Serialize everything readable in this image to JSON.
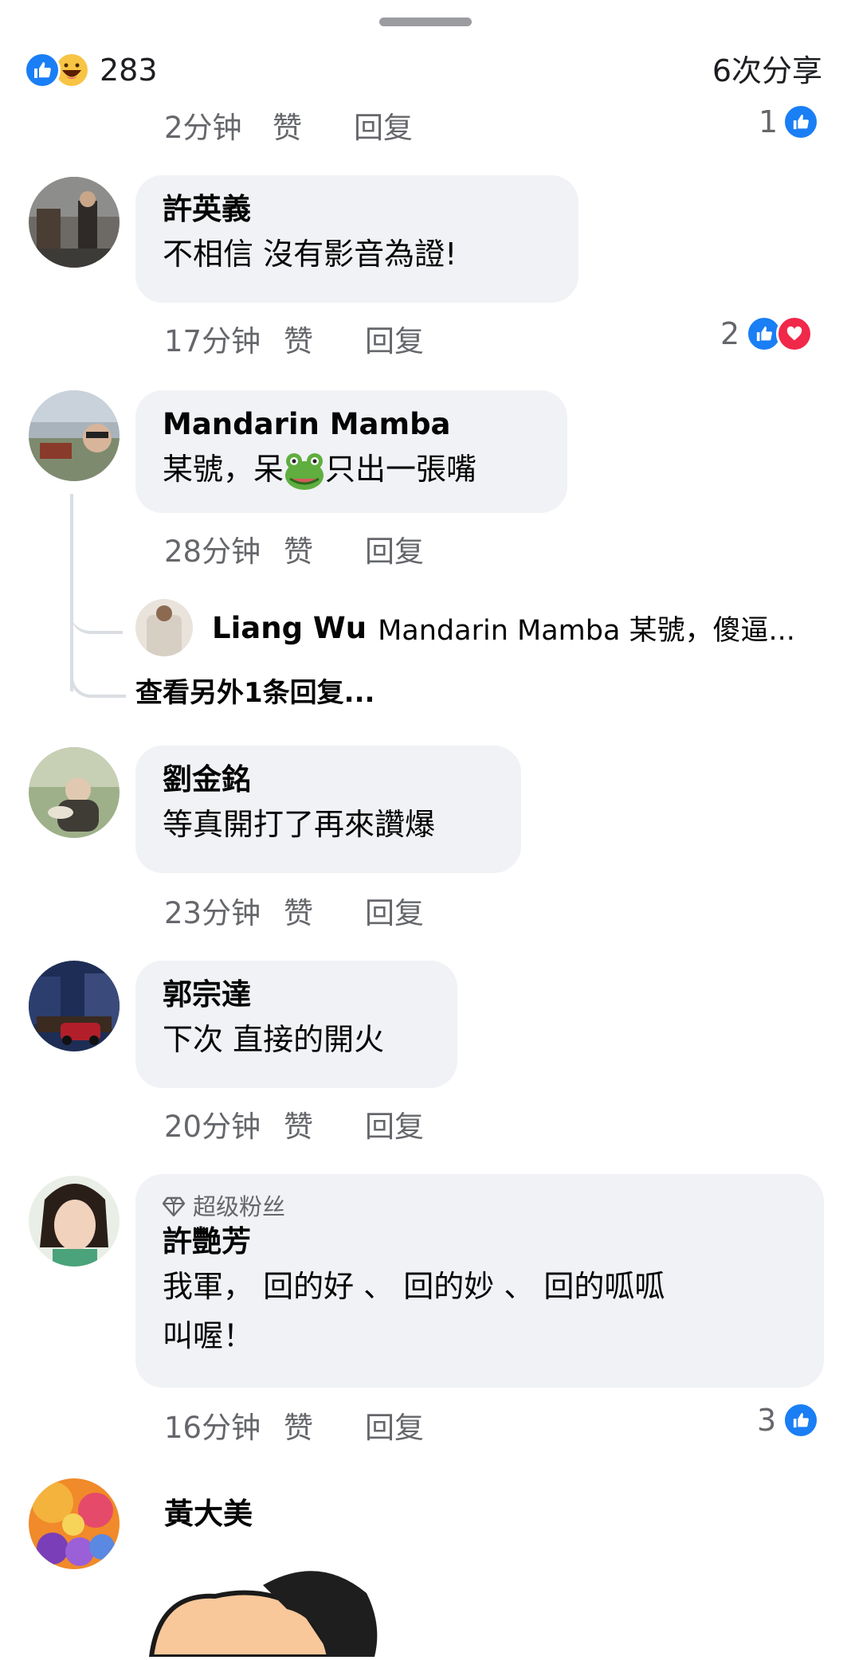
{
  "header": {
    "reaction_count": "283",
    "shares": "6次分享",
    "reaction_icons": [
      "like-icon",
      "haha-icon"
    ]
  },
  "labels": {
    "like": "赞",
    "reply": "回复"
  },
  "top_partial": {
    "time": "2分钟",
    "like": "赞",
    "reply": "回复",
    "reaction_count": "1"
  },
  "comments": [
    {
      "author": "許英義",
      "text": "不相信  沒有影音為證!",
      "time": "17分钟",
      "reaction_count": "2",
      "reactions": [
        "like-icon",
        "love-icon"
      ]
    },
    {
      "author": "Mandarin Mamba",
      "text_before": "某號，呆",
      "emoji": "frog-emoji",
      "text_after": "只出一張嘴",
      "time": "28分钟",
      "reply": {
        "author": "Liang Wu",
        "snippet": "Mandarin Mamba 某號，傻逼..."
      },
      "more_replies": "查看另外1条回复..."
    },
    {
      "author": "劉金銘",
      "text": "等真開打了再來讚爆",
      "time": "23分钟"
    },
    {
      "author": "郭宗達",
      "text": "下次 直接的開火",
      "time": "20分钟"
    },
    {
      "badge": "超级粉丝",
      "badge_icon": "diamond-icon",
      "author": "許艷芳",
      "text_line1": "我軍，  回的好 、 回的妙 、  回的呱呱",
      "text_line2": "叫喔！",
      "time": "16分钟",
      "reaction_count": "3",
      "reactions": [
        "like-icon"
      ]
    },
    {
      "author": "黃大美"
    }
  ],
  "colors": {
    "like_blue": "#1a7ef5",
    "love_red": "#f0284a",
    "bubble_bg": "#f0f2f5",
    "meta_gray": "#65676b"
  }
}
